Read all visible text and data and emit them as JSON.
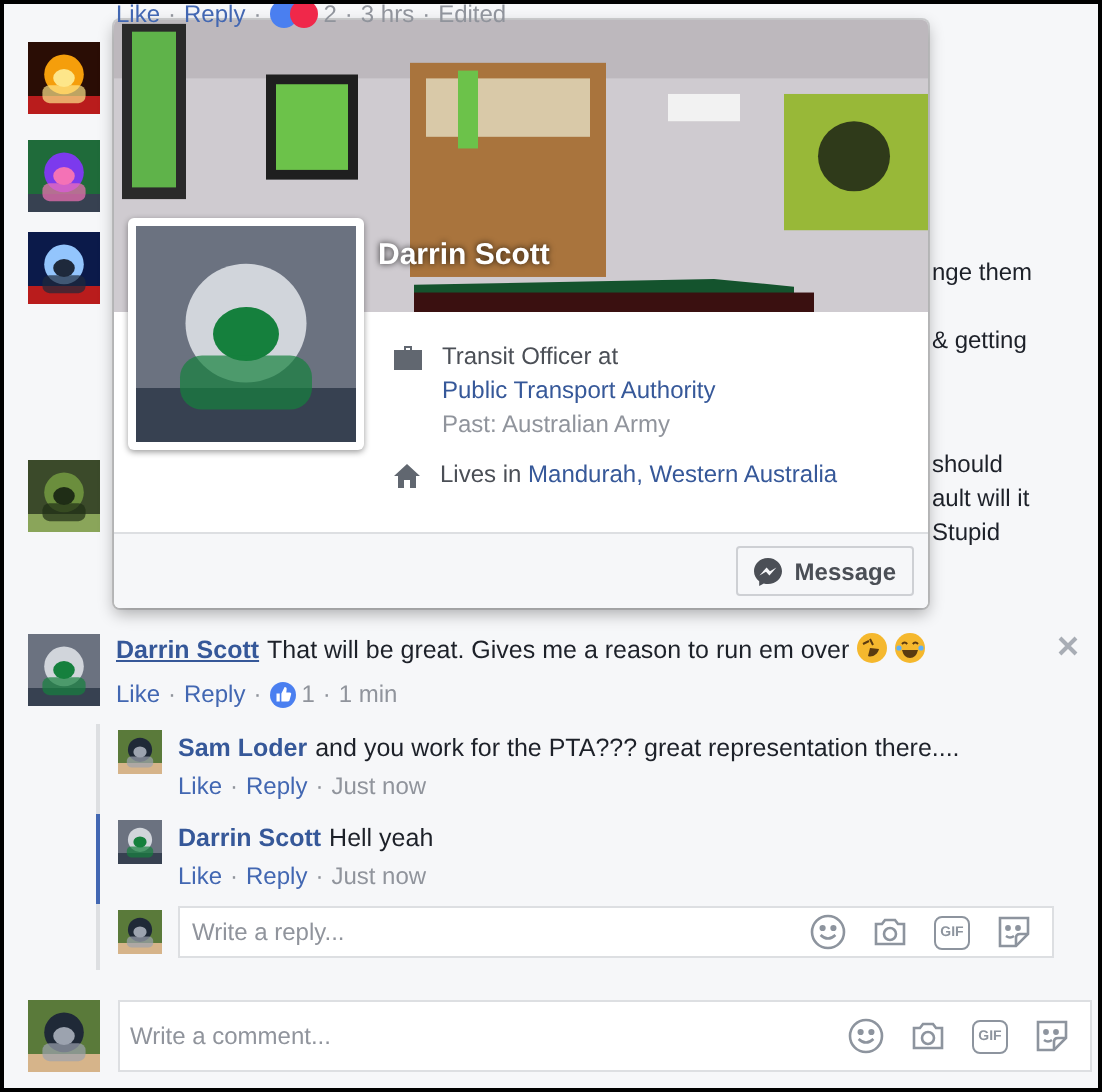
{
  "separator": "·",
  "top_comment_actions": {
    "like": "Like",
    "reply": "Reply",
    "reaction_count": "2",
    "time": "3 hrs",
    "edited": "Edited"
  },
  "hidden_comment_fragments": [
    "nge them",
    "& getting",
    "should",
    "ault will it",
    "Stupid"
  ],
  "profile_card": {
    "name": "Darrin Scott",
    "work_prefix": "Transit Officer at ",
    "work_link": "Public Transport Authority",
    "past": "Past: Australian Army",
    "lives_prefix": "Lives in ",
    "city": "Mandurah",
    "city_separator": ", ",
    "region": "Western Australia",
    "message_button": "Message"
  },
  "comment": {
    "author": "Darrin Scott",
    "text": "That will be great. Gives me a reason to run em over",
    "like": "Like",
    "reply": "Reply",
    "like_count": "1",
    "time": "1 min",
    "replies": [
      {
        "author": "Sam Loder",
        "text": "and you work for the PTA??? great representation there....",
        "like": "Like",
        "reply": "Reply",
        "time": "Just now",
        "selected": false
      },
      {
        "author": "Darrin Scott",
        "text": "Hell yeah",
        "like": "Like",
        "reply": "Reply",
        "time": "Just now",
        "selected": true
      }
    ]
  },
  "reply_box": {
    "placeholder": "Write a reply...",
    "gif_label": "GIF"
  },
  "comment_box": {
    "placeholder": "Write a comment...",
    "gif_label": "GIF"
  }
}
